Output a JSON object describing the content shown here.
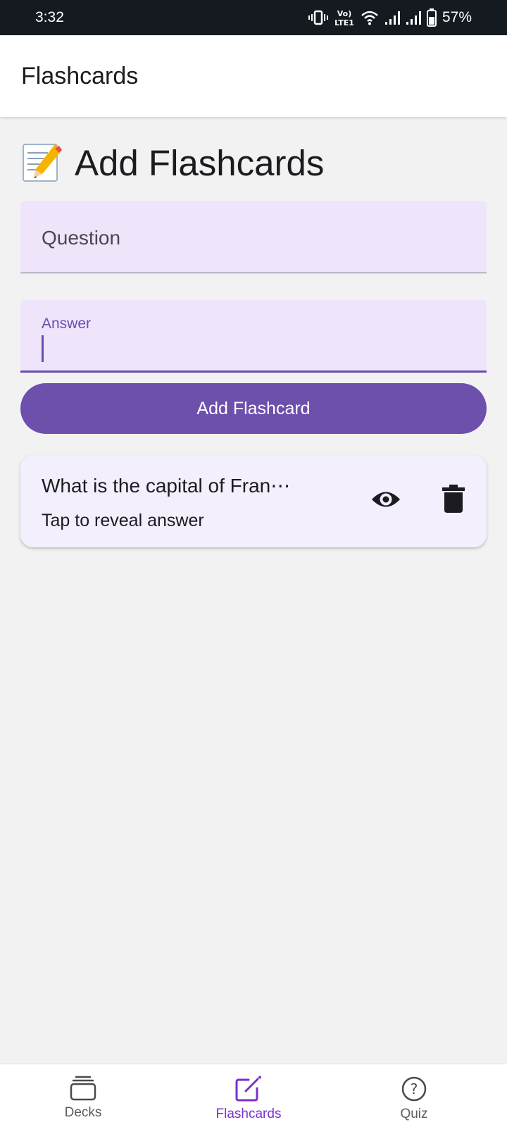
{
  "status_bar": {
    "time": "3:32",
    "battery": "57%",
    "network_badge": "Vo) LTE1",
    "icons": [
      "vibrate-icon",
      "volte-icon",
      "wifi-icon",
      "signal-icon",
      "signal-icon",
      "battery-icon"
    ]
  },
  "app_bar": {
    "title": "Flashcards"
  },
  "section": {
    "emoji_icon": "memo-icon",
    "title": "Add Flashcards"
  },
  "form": {
    "question": {
      "placeholder": "Question",
      "value": ""
    },
    "answer": {
      "label": "Answer",
      "value": ""
    },
    "submit_label": "Add Flashcard"
  },
  "flashcards": [
    {
      "question": "What is the capital of Fran⋯",
      "hint": "Tap to reveal answer",
      "actions": [
        "eye-icon",
        "trash-icon"
      ]
    }
  ],
  "bottom_nav": {
    "items": [
      {
        "label": "Decks",
        "icon": "decks-icon",
        "active": false
      },
      {
        "label": "Flashcards",
        "icon": "edit-icon",
        "active": true
      },
      {
        "label": "Quiz",
        "icon": "help-circle-icon",
        "active": false
      }
    ],
    "active_color": "#7b2fd0"
  },
  "colors": {
    "primary": "#6d4fac",
    "field_background": "#efe5fb",
    "card_background": "#f3effc",
    "page_background": "#f2f2f2"
  }
}
